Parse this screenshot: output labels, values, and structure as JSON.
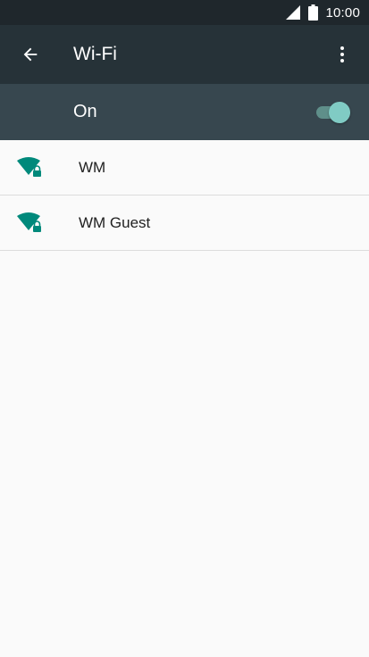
{
  "status_bar": {
    "time": "10:00",
    "icons": [
      "signal-icon",
      "battery-icon"
    ]
  },
  "app_bar": {
    "title": "Wi-Fi",
    "back_icon": "arrow-back-icon",
    "menu_icon": "more-vert-icon"
  },
  "wifi_toggle": {
    "label": "On",
    "state": true
  },
  "networks": [
    {
      "name": "WM",
      "icon": "wifi-locked-icon"
    },
    {
      "name": "WM Guest",
      "icon": "wifi-locked-icon"
    }
  ],
  "colors": {
    "status_bar": "#1f272c",
    "app_bar": "#263238",
    "toggle_bar": "#37474f",
    "accent": "#00897b",
    "switch_thumb": "#80cbc4",
    "background": "#fafafa"
  }
}
